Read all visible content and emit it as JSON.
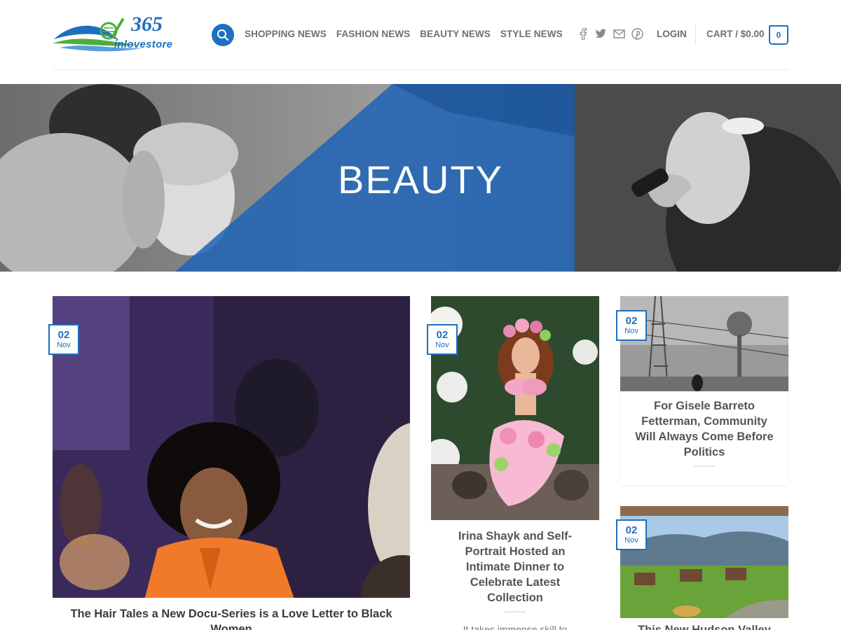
{
  "brand": {
    "logo_top": "365",
    "logo_bottom": "inlovestore"
  },
  "nav": {
    "items": [
      "SHOPPING NEWS",
      "FASHION NEWS",
      "BEAUTY NEWS",
      "STYLE NEWS"
    ],
    "login": "LOGIN",
    "cart_label": "CART / $0.00",
    "cart_count": "0"
  },
  "icons": {
    "search": "search-icon",
    "social": [
      "facebook-icon",
      "twitter-icon",
      "envelope-icon",
      "pinterest-icon"
    ]
  },
  "colors": {
    "accent": "#1f6fc0",
    "nav_text": "#6f6f6f",
    "title_text": "#555555"
  },
  "banner": {
    "title": "BEAUTY"
  },
  "posts": [
    {
      "day": "02",
      "month": "Nov",
      "title": "The Hair Tales a New Docu-Series is a Love Letter to Black Women"
    },
    {
      "day": "02",
      "month": "Nov",
      "title": "Irina Shayk and Self-Portrait Hosted an Intimate Dinner to Celebrate Latest Collection",
      "excerpt": "It takes immense skill to"
    },
    {
      "day": "02",
      "month": "Nov",
      "title": "For Gisele Barreto Fetterman, Community Will Always Come Before Politics"
    },
    {
      "day": "02",
      "month": "Nov",
      "title": "This New Hudson Valley"
    }
  ]
}
